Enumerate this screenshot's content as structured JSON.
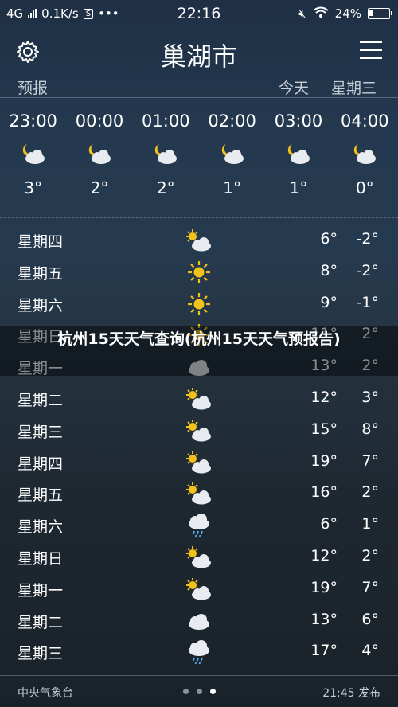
{
  "status": {
    "network": "4G",
    "speed": "0.1K/s",
    "time": "22:16",
    "battery": "24%",
    "battery_level": 0.24
  },
  "header": {
    "city": "巢湖市",
    "forecast_label": "预报",
    "today_label": "今天",
    "weekday_label": "星期三"
  },
  "hourly": [
    {
      "time": "23:00",
      "temp": "3°",
      "icon": "cloud-moon-icon"
    },
    {
      "time": "00:00",
      "temp": "2°",
      "icon": "cloud-moon-icon"
    },
    {
      "time": "01:00",
      "temp": "2°",
      "icon": "cloud-moon-icon"
    },
    {
      "time": "02:00",
      "temp": "1°",
      "icon": "cloud-moon-icon"
    },
    {
      "time": "03:00",
      "temp": "1°",
      "icon": "cloud-moon-icon"
    },
    {
      "time": "04:00",
      "temp": "0°",
      "icon": "cloud-moon-icon"
    }
  ],
  "daily": [
    {
      "day": "星期四",
      "high": "6°",
      "low": "-2°",
      "icon": "partly-cloudy-icon"
    },
    {
      "day": "星期五",
      "high": "8°",
      "low": "-2°",
      "icon": "sunny-icon"
    },
    {
      "day": "星期六",
      "high": "9°",
      "low": "-1°",
      "icon": "sunny-icon"
    },
    {
      "day": "星期日",
      "high": "11°",
      "low": "2°",
      "icon": "sunny-icon"
    },
    {
      "day": "星期一",
      "high": "13°",
      "low": "2°",
      "icon": "cloudy-icon"
    },
    {
      "day": "星期二",
      "high": "12°",
      "low": "3°",
      "icon": "partly-cloudy-icon"
    },
    {
      "day": "星期三",
      "high": "15°",
      "low": "8°",
      "icon": "partly-cloudy-icon"
    },
    {
      "day": "星期四",
      "high": "19°",
      "low": "7°",
      "icon": "partly-cloudy-icon"
    },
    {
      "day": "星期五",
      "high": "16°",
      "low": "2°",
      "icon": "partly-cloudy-icon"
    },
    {
      "day": "星期六",
      "high": "6°",
      "low": "1°",
      "icon": "rain-icon"
    },
    {
      "day": "星期日",
      "high": "12°",
      "low": "2°",
      "icon": "partly-cloudy-icon"
    },
    {
      "day": "星期一",
      "high": "19°",
      "low": "7°",
      "icon": "partly-cloudy-icon"
    },
    {
      "day": "星期二",
      "high": "13°",
      "low": "6°",
      "icon": "cloudy-icon"
    },
    {
      "day": "星期三",
      "high": "17°",
      "low": "4°",
      "icon": "rain-icon"
    }
  ],
  "overlay_text": "杭州15天天气查询(杭州15天天气预报告)",
  "footer": {
    "source": "中央气象台",
    "published": "21:45 发布",
    "page_count": 3,
    "active_page": 3
  }
}
